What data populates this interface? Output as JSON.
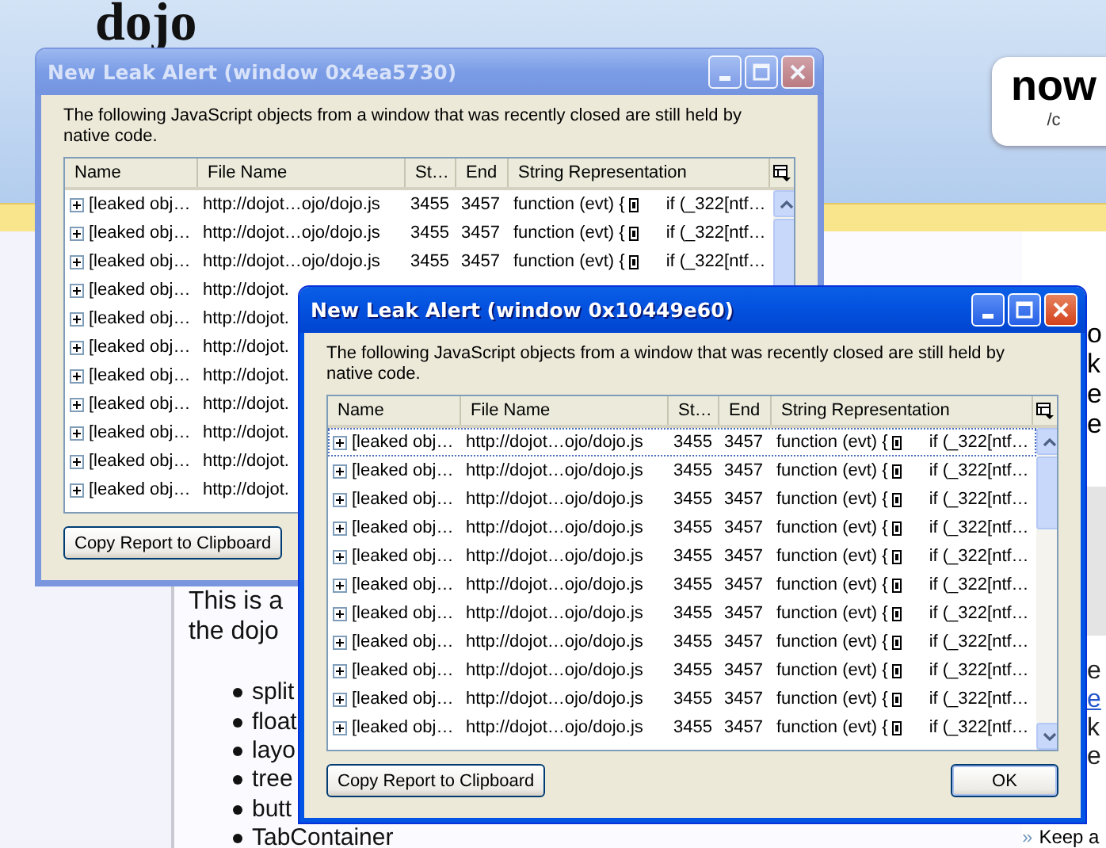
{
  "page": {
    "logo": "dojo",
    "badge": {
      "title": "now",
      "subtitle": "/c"
    },
    "intro": [
      "This is a",
      "the dojo"
    ],
    "bullets": [
      "split",
      "float",
      "layo",
      "tree",
      "butt",
      "TabContainer"
    ],
    "side_notes": [
      "o",
      "k",
      "e",
      "e"
    ],
    "side_links": [
      {
        "text": "e",
        "kind": "text"
      },
      {
        "text": "e",
        "kind": "link"
      },
      {
        "text": "k",
        "kind": "text"
      },
      {
        "text": "e",
        "kind": "text"
      }
    ],
    "footer_link": {
      "marker": "»",
      "text": "Keep a"
    }
  },
  "windows": [
    {
      "title": "New Leak Alert (window 0x4ea5730)",
      "active": false,
      "message": "The following JavaScript objects from a window that was recently closed are still held by native code.",
      "columns": [
        "Name",
        "File Name",
        "St…",
        "End",
        "String Representation"
      ],
      "rows": [
        {
          "name": "[leaked obj…",
          "file": "http://dojot…ojo/dojo.js",
          "start": "3455",
          "end": "3457",
          "code": "function (evt) {",
          "code_more": "if (_322[ntf…",
          "focused": false
        },
        {
          "name": "[leaked obj…",
          "file": "http://dojot…ojo/dojo.js",
          "start": "3455",
          "end": "3457",
          "code": "function (evt) {",
          "code_more": "if (_322[ntf…",
          "focused": false
        },
        {
          "name": "[leaked obj…",
          "file": "http://dojot…ojo/dojo.js",
          "start": "3455",
          "end": "3457",
          "code": "function (evt) {",
          "code_more": "if (_322[ntf…",
          "focused": false
        },
        {
          "name": "[leaked obj…",
          "file": "http://dojot.",
          "focused": false
        },
        {
          "name": "[leaked obj…",
          "file": "http://dojot.",
          "focused": false
        },
        {
          "name": "[leaked obj…",
          "file": "http://dojot.",
          "focused": false
        },
        {
          "name": "[leaked obj…",
          "file": "http://dojot.",
          "focused": false
        },
        {
          "name": "[leaked obj…",
          "file": "http://dojot.",
          "focused": false
        },
        {
          "name": "[leaked obj…",
          "file": "http://dojot.",
          "focused": false
        },
        {
          "name": "[leaked obj…",
          "file": "http://dojot.",
          "focused": false
        },
        {
          "name": "[leaked obj…",
          "file": "http://dojot.",
          "focused": false
        }
      ],
      "buttons": [
        {
          "label": "Copy Report to Clipboard",
          "default": false
        }
      ]
    },
    {
      "title": "New Leak Alert (window 0x10449e60)",
      "active": true,
      "message": "The following JavaScript objects from a window that was recently closed are still held by native code.",
      "columns": [
        "Name",
        "File Name",
        "St…",
        "End",
        "String Representation"
      ],
      "rows": [
        {
          "name": "[leaked obj…",
          "file": "http://dojot…ojo/dojo.js",
          "start": "3455",
          "end": "3457",
          "code": "function (evt) {",
          "code_more": "if (_322[ntf…",
          "focused": true
        },
        {
          "name": "[leaked obj…",
          "file": "http://dojot…ojo/dojo.js",
          "start": "3455",
          "end": "3457",
          "code": "function (evt) {",
          "code_more": "if (_322[ntf…",
          "focused": false
        },
        {
          "name": "[leaked obj…",
          "file": "http://dojot…ojo/dojo.js",
          "start": "3455",
          "end": "3457",
          "code": "function (evt) {",
          "code_more": "if (_322[ntf…",
          "focused": false
        },
        {
          "name": "[leaked obj…",
          "file": "http://dojot…ojo/dojo.js",
          "start": "3455",
          "end": "3457",
          "code": "function (evt) {",
          "code_more": "if (_322[ntf…",
          "focused": false
        },
        {
          "name": "[leaked obj…",
          "file": "http://dojot…ojo/dojo.js",
          "start": "3455",
          "end": "3457",
          "code": "function (evt) {",
          "code_more": "if (_322[ntf…",
          "focused": false
        },
        {
          "name": "[leaked obj…",
          "file": "http://dojot…ojo/dojo.js",
          "start": "3455",
          "end": "3457",
          "code": "function (evt) {",
          "code_more": "if (_322[ntf…",
          "focused": false
        },
        {
          "name": "[leaked obj…",
          "file": "http://dojot…ojo/dojo.js",
          "start": "3455",
          "end": "3457",
          "code": "function (evt) {",
          "code_more": "if (_322[ntf…",
          "focused": false
        },
        {
          "name": "[leaked obj…",
          "file": "http://dojot…ojo/dojo.js",
          "start": "3455",
          "end": "3457",
          "code": "function (evt) {",
          "code_more": "if (_322[ntf…",
          "focused": false
        },
        {
          "name": "[leaked obj…",
          "file": "http://dojot…ojo/dojo.js",
          "start": "3455",
          "end": "3457",
          "code": "function (evt) {",
          "code_more": "if (_322[ntf…",
          "focused": false
        },
        {
          "name": "[leaked obj…",
          "file": "http://dojot…ojo/dojo.js",
          "start": "3455",
          "end": "3457",
          "code": "function (evt) {",
          "code_more": "if (_322[ntf…",
          "focused": false
        },
        {
          "name": "[leaked obj…",
          "file": "http://dojot…ojo/dojo.js",
          "start": "3455",
          "end": "3457",
          "code": "function (evt) {",
          "code_more": "if (_322[ntf…",
          "focused": false
        }
      ],
      "buttons": [
        {
          "label": "Copy Report to Clipboard",
          "default": false
        },
        {
          "label": "OK",
          "default": true
        }
      ]
    }
  ]
}
